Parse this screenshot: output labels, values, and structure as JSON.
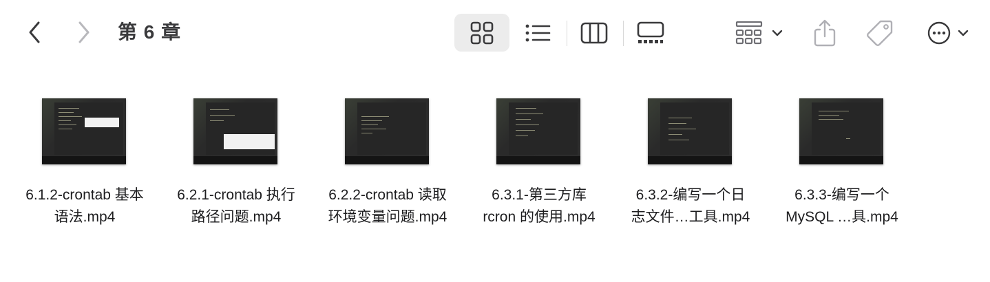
{
  "toolbar": {
    "title": "第 6 章",
    "icons": {
      "back": "chevron-left-icon",
      "forward": "chevron-right-icon",
      "icon_view": "grid-view-icon",
      "list_view": "list-view-icon",
      "column_view": "column-view-icon",
      "gallery_view": "gallery-view-icon",
      "group": "group-by-icon",
      "share": "share-icon",
      "tag": "tag-icon",
      "more": "more-actions-icon"
    },
    "active_view": "icon"
  },
  "files": [
    {
      "line1": "6.1.2-crontab 基本",
      "line2": "语法.mp4"
    },
    {
      "line1": "6.2.1-crontab 执行",
      "line2": "路径问题.mp4"
    },
    {
      "line1": "6.2.2-crontab 读取",
      "line2": "环境变量问题.mp4"
    },
    {
      "line1": "6.3.1-第三方库",
      "line2": "rcron 的使用.mp4"
    },
    {
      "line1": "6.3.2-编写一个日",
      "line2": "志文件…工具.mp4"
    },
    {
      "line1": "6.3.3-编写一个",
      "line2": "MySQL …具.mp4"
    }
  ],
  "colors": {
    "icon_gray": "#8e8e93",
    "icon_dark": "#3a3a3c",
    "active_bg": "#ececec"
  }
}
